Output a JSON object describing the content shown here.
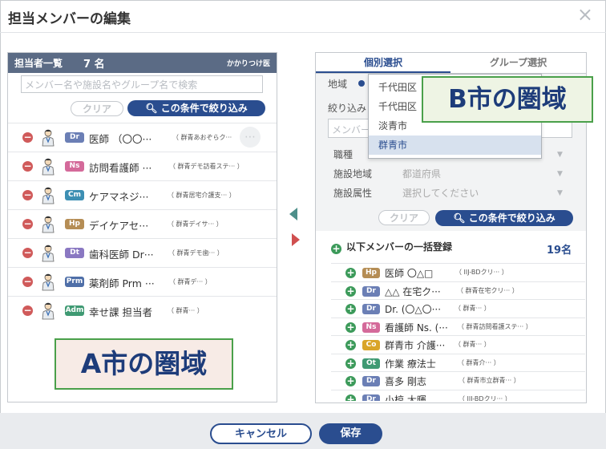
{
  "dialog": {
    "title": "担当メンバーの編集",
    "close_icon": "×"
  },
  "left": {
    "header": {
      "label": "担当者一覧",
      "count": "7 名",
      "right_label": "かかりつけ医"
    },
    "search_placeholder": "メンバー名や施設名やグループ名で検索",
    "clear_label": "クリア",
    "filter_label": "この条件で絞り込み",
    "rows": [
      {
        "badge": "Dr",
        "badge_color": "#6b7fb5",
        "name": "医師 （〇〇···",
        "org": "（ 群青あおぞらク···"
      },
      {
        "badge": "Ns",
        "badge_color": "#d46a9a",
        "name": "訪問看護師 ···",
        "org": "（ 群青デモ訪看ステ···         ）"
      },
      {
        "badge": "Cm",
        "badge_color": "#3d8fb3",
        "name": "ケアマネジ···",
        "org": "（ 群青居宅介護支···           ）"
      },
      {
        "badge": "Hp",
        "badge_color": "#b58d55",
        "name": "デイケアセ···",
        "org": "（ 群青デイサ···         ）"
      },
      {
        "badge": "Dt",
        "badge_color": "#8a78c2",
        "name": "歯科医師 Dr···",
        "org": "（ 群青デモ歯···         ）"
      },
      {
        "badge": "Prm",
        "badge_color": "#4f6fa8",
        "name": "薬剤師 Prm ···",
        "org": "（ 群青デ···         ）"
      },
      {
        "badge": "Adm",
        "badge_color": "#3f9a73",
        "name": "幸せ課 担当者",
        "org": "（ 群青···         ）"
      }
    ]
  },
  "stamps": {
    "a": "A市の圏域",
    "b": "B市の圏域"
  },
  "right": {
    "tabs": [
      "個別選択",
      "グループ選択"
    ],
    "area_label": "地域",
    "narrow_label": "絞り込み",
    "member_placeholder": "メンバー",
    "fields": [
      {
        "label": "職種",
        "value": ""
      },
      {
        "label": "施設地域",
        "value": "都道府県"
      },
      {
        "label": "施設属性",
        "value": "選択してください"
      }
    ],
    "dropdown_options": [
      "千代田区",
      "千代田区",
      "淡青市",
      "群青市"
    ],
    "dropdown_selected": 3,
    "clear_label": "クリア",
    "filter_label": "この条件で絞り込み",
    "bulk_label": "以下メンバーの一括登録",
    "bulk_count": "19名",
    "rows": [
      {
        "badge": "Hp",
        "badge_color": "#b58d55",
        "name": "医師 〇△□",
        "org": "（ IIJ-BDクリ···         ）"
      },
      {
        "badge": "Dr",
        "badge_color": "#6b7fb5",
        "name": "△△ 在宅ク···",
        "org": "（ 群青在宅クリ···         ）"
      },
      {
        "badge": "Dr",
        "badge_color": "#6b7fb5",
        "name": "Dr. (〇△〇···",
        "org": "（ 群青···         ）"
      },
      {
        "badge": "Ns",
        "badge_color": "#d46a9a",
        "name": "看護師 Ns. (···",
        "org": "（ 群青訪問看護ステ···           ）"
      },
      {
        "badge": "Co",
        "badge_color": "#d9a52a",
        "name": "群青市 介護···",
        "org": "（ 群青···         ）"
      },
      {
        "badge": "Ot",
        "badge_color": "#3f9a73",
        "name": "作業 療法士",
        "org": "（ 群青介···           ）"
      },
      {
        "badge": "Dr",
        "badge_color": "#6b7fb5",
        "name": "喜多 剛志",
        "org": "（ 群青市立群青···         ）"
      },
      {
        "badge": "Dr",
        "badge_color": "#6b7fb5",
        "name": "小椋 大暉",
        "org": "（ IIJ-BDクリ···         ）"
      }
    ]
  },
  "footer": {
    "cancel_label": "キャンセル",
    "save_label": "保存"
  }
}
